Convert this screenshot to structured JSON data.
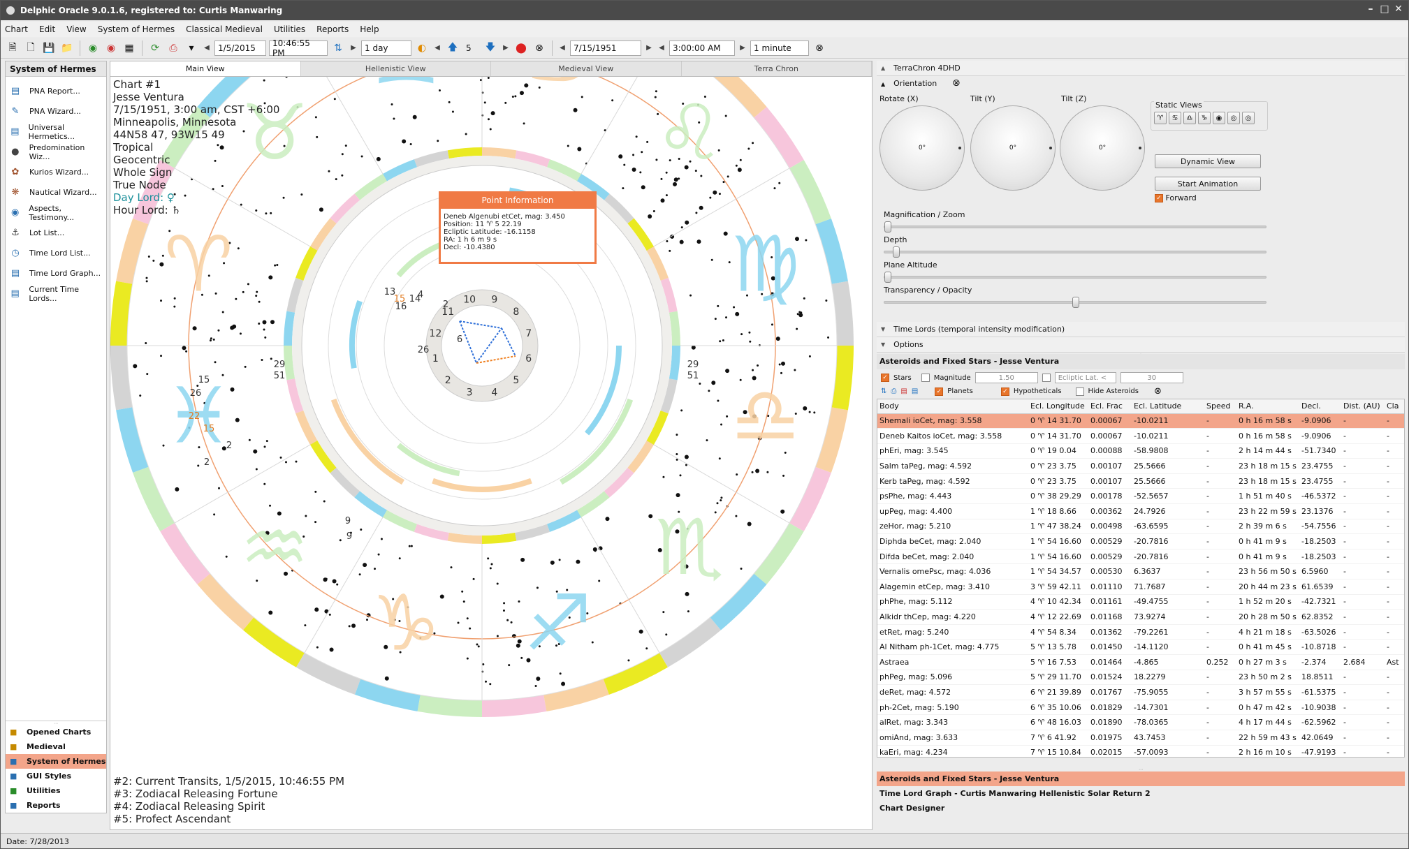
{
  "window": {
    "title": "Delphic Oracle 9.0.1.6, registered to: Curtis Manwaring"
  },
  "menu": [
    "Chart",
    "Edit",
    "View",
    "System of Hermes",
    "Classical Medieval",
    "Utilities",
    "Reports",
    "Help"
  ],
  "toolbar": {
    "date1": "1/5/2015",
    "time1": "10:46:55 PM",
    "step1": "1 day",
    "count": "5",
    "date2": "7/15/1951",
    "time2": "3:00:00 AM",
    "step2": "1 minute"
  },
  "sidebar": {
    "title": "System of Hermes",
    "items": [
      "PNA Report...",
      "PNA Wizard...",
      "Universal Hermetics...",
      "Predomination Wiz...",
      "Kurios Wizard...",
      "Nautical Wizard...",
      "Aspects, Testimony...",
      "Lot List...",
      "Time Lord List...",
      "Time Lord Graph...",
      "Current Time Lords..."
    ],
    "bottom": [
      "Opened Charts",
      "Medieval",
      "System of Hermes",
      "GUI Styles",
      "Utilities",
      "Reports"
    ]
  },
  "tabs": [
    "Main View",
    "Hellenistic View",
    "Medieval View",
    "Terra Chron"
  ],
  "chart_info": {
    "lines": [
      "Chart #1",
      "Jesse Ventura",
      "7/15/1951, 3:00 am, CST +6:00",
      "Minneapolis, Minnesota",
      "44N58 47, 93W15 49",
      "Tropical",
      "Geocentric",
      "Whole Sign",
      "True Node"
    ],
    "day_lord": "Day Lord: ♀",
    "hour_lord": "Hour Lord: ♄",
    "footer": [
      "#2: Current Transits, 1/5/2015, 10:46:55 PM",
      "#3: Zodiacal Releasing Fortune",
      "#4: Zodiacal Releasing Spirit",
      "#5: Profect Ascendant"
    ]
  },
  "wheel": {
    "house_numbers": [
      "12",
      "11",
      "10",
      "9",
      "8",
      "7",
      "6",
      "5",
      "4",
      "3",
      "2",
      "1"
    ],
    "labels": [
      "13",
      "15",
      "6",
      "26",
      "4",
      "2",
      "16",
      "14",
      "29",
      "51",
      "29",
      "51",
      "15",
      "26",
      "22",
      "15",
      "2",
      "2",
      "9",
      "9"
    ],
    "zodiac_glyphs": [
      "♈",
      "♉",
      "♊",
      "♋",
      "♌",
      "♍",
      "♎",
      "♏",
      "♐",
      "♑",
      "♒",
      "♓"
    ]
  },
  "popup": {
    "title": "Point Information",
    "lines": [
      "Deneb Algenubi   etCet, mag: 3.450",
      "Position: 11 ♈ 5 22.19",
      "Ecliptic Latitude: -16.1158",
      "RA: 1 h 6 m 9 s",
      "Decl: -10.4380"
    ]
  },
  "terrachron": {
    "title": "TerraChron 4DHD",
    "orientation": "Orientation",
    "rotate": "Rotate (X)",
    "tilt_y": "Tilt (Y)",
    "tilt_z": "Tilt (Z)",
    "dial_value": "0°",
    "static_views": "Static Views",
    "dynamic_view": "Dynamic View",
    "start_animation": "Start Animation",
    "forward": "Forward",
    "magnification": "Magnification / Zoom",
    "depth": "Depth",
    "plane_altitude": "Plane Altitude",
    "transparency": "Transparency / Opacity",
    "transparency_level": 0.5,
    "time_lords": "Time Lords (temporal intensity modification)",
    "options": "Options"
  },
  "asteroids": {
    "title": "Asteroids and Fixed Stars - Jesse Ventura",
    "stars": "Stars",
    "magnitude": "Magnitude",
    "mag_value": "1.50",
    "ecl_lat": "Ecliptic Lat. <",
    "ecl_value": "30",
    "planets": "Planets",
    "hypotheticals": "Hypotheticals",
    "hide_asteroids": "Hide Asteroids",
    "columns": [
      "Body",
      "Ecl. Longitude",
      "Ecl. Frac",
      "Ecl. Latitude",
      "Speed",
      "R.A.",
      "Decl.",
      "Dist. (AU)",
      "Cla"
    ],
    "rows": [
      [
        "Shemali   ioCet, mag: 3.558",
        "0 ♈ 14 31.70",
        "0.00067",
        "-10.0211",
        "-",
        "0 h 16 m 58 s",
        "-9.0906",
        "-",
        "-"
      ],
      [
        "Deneb Kaitos   ioCet, mag: 3.558",
        "0 ♈ 14 31.70",
        "0.00067",
        "-10.0211",
        "-",
        "0 h 16 m 58 s",
        "-9.0906",
        "-",
        "-"
      ],
      [
        "   phEri, mag: 3.545",
        "0 ♈ 19 0.04",
        "0.00088",
        "-58.9808",
        "-",
        "2 h 14 m 44 s",
        "-51.7340",
        "-",
        "-"
      ],
      [
        "Salm   taPeg, mag: 4.592",
        "0 ♈ 23 3.75",
        "0.00107",
        "25.5666",
        "-",
        "23 h 18 m 15 s",
        "23.4755",
        "-",
        "-"
      ],
      [
        "Kerb   taPeg, mag: 4.592",
        "0 ♈ 23 3.75",
        "0.00107",
        "25.5666",
        "-",
        "23 h 18 m 15 s",
        "23.4755",
        "-",
        "-"
      ],
      [
        "   psPhe, mag: 4.443",
        "0 ♈ 38 29.29",
        "0.00178",
        "-52.5657",
        "-",
        "1 h 51 m 40 s",
        "-46.5372",
        "-",
        "-"
      ],
      [
        "   upPeg, mag: 4.400",
        "1 ♈ 18 8.66",
        "0.00362",
        "24.7926",
        "-",
        "23 h 22 m 59 s",
        "23.1376",
        "-",
        "-"
      ],
      [
        "   zeHor, mag: 5.210",
        "1 ♈ 47 38.24",
        "0.00498",
        "-63.6595",
        "-",
        "2 h 39 m 6 s",
        "-54.7556",
        "-",
        "-"
      ],
      [
        "Diphda   beCet, mag: 2.040",
        "1 ♈ 54 16.60",
        "0.00529",
        "-20.7816",
        "-",
        "0 h 41 m 9 s",
        "-18.2503",
        "-",
        "-"
      ],
      [
        "Difda   beCet, mag: 2.040",
        "1 ♈ 54 16.60",
        "0.00529",
        "-20.7816",
        "-",
        "0 h 41 m 9 s",
        "-18.2503",
        "-",
        "-"
      ],
      [
        "Vernalis   omePsc, mag: 4.036",
        "1 ♈ 54 34.57",
        "0.00530",
        "6.3637",
        "-",
        "23 h 56 m 50 s",
        "6.5960",
        "-",
        "-"
      ],
      [
        "Alagemin   etCep, mag: 3.410",
        "3 ♈ 59 42.11",
        "0.01110",
        "71.7687",
        "-",
        "20 h 44 m 23 s",
        "61.6539",
        "-",
        "-"
      ],
      [
        "   phPhe, mag: 5.112",
        "4 ♈ 10 42.34",
        "0.01161",
        "-49.4755",
        "-",
        "1 h 52 m 20 s",
        "-42.7321",
        "-",
        "-"
      ],
      [
        "Alkidr   thCep, mag: 4.220",
        "4 ♈ 12 22.69",
        "0.01168",
        "73.9274",
        "-",
        "20 h 28 m 50 s",
        "62.8352",
        "-",
        "-"
      ],
      [
        "   etRet, mag: 5.240",
        "4 ♈ 54 8.34",
        "0.01362",
        "-79.2261",
        "-",
        "4 h 21 m 18 s",
        "-63.5026",
        "-",
        "-"
      ],
      [
        "Al Nitham   ph-1Cet, mag: 4.775",
        "5 ♈ 13 5.78",
        "0.01450",
        "-14.1120",
        "-",
        "0 h 41 m 45 s",
        "-10.8718",
        "-",
        "-"
      ],
      [
        "Astraea",
        "5 ♈ 16 7.53",
        "0.01464",
        "-4.865",
        "0.252",
        "0 h 27 m 3 s",
        "-2.374",
        "2.684",
        "Ast"
      ],
      [
        "   phPeg, mag: 5.096",
        "5 ♈ 29 11.70",
        "0.01524",
        "18.2279",
        "-",
        "23 h 50 m 2 s",
        "18.8511",
        "-",
        "-"
      ],
      [
        "   deRet, mag: 4.572",
        "6 ♈ 21 39.89",
        "0.01767",
        "-75.9055",
        "-",
        "3 h 57 m 55 s",
        "-61.5375",
        "-",
        "-"
      ],
      [
        "   ph-2Cet, mag: 5.190",
        "6 ♈ 35 10.06",
        "0.01829",
        "-14.7301",
        "-",
        "0 h 47 m 42 s",
        "-10.9038",
        "-",
        "-"
      ],
      [
        "   alRet, mag: 3.343",
        "6 ♈ 48 16.03",
        "0.01890",
        "-78.0365",
        "-",
        "4 h 17 m 44 s",
        "-62.5962",
        "-",
        "-"
      ],
      [
        "   omiAnd, mag: 3.633",
        "7 ♈ 6 41.92",
        "0.01975",
        "43.7453",
        "-",
        "22 h 59 m 43 s",
        "42.0649",
        "-",
        "-"
      ],
      [
        "   kaEri, mag: 4.234",
        "7 ♈ 15 10.84",
        "0.02015",
        "-57.0093",
        "-",
        "2 h 16 m 10 s",
        "-47.9193",
        "-",
        "-"
      ]
    ]
  },
  "bottom_list": [
    "Asteroids and Fixed Stars - Jesse Ventura",
    "Time Lord Graph - Curtis Manwaring Hellenistic Solar Return 2",
    "Chart Designer"
  ],
  "status": {
    "date": "Date: 7/28/2013"
  },
  "colors": {
    "accent": "#f07a45",
    "selection": "#f3a58a",
    "ring_blue": "#8dd6f0",
    "ring_orange": "#f9d2a4",
    "ring_green": "#cbeec0",
    "ring_pink": "#f7c6dc",
    "ring_yellow": "#eaea22",
    "ring_gray": "#d4d4d4"
  }
}
